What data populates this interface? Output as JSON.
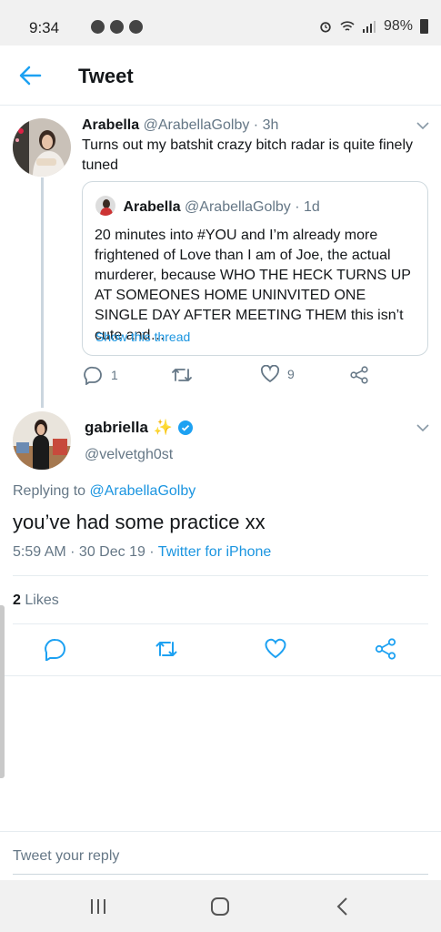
{
  "status_bar": {
    "time": "9:34",
    "battery": "98%"
  },
  "app_bar": {
    "title": "Tweet"
  },
  "parent_tweet": {
    "name": "Arabella",
    "handle": "@ArabellaGolby",
    "time": "· 3h",
    "text": "Turns out my batshit crazy bitch radar is quite finely tuned",
    "quoted": {
      "name": "Arabella",
      "handle": "@ArabellaGolby",
      "time": "· 1d",
      "text": "20 minutes into #YOU and I’m already more frightened of Love than I am of Joe, the actual murderer, because WHO THE HECK TURNS UP AT SOMEONES HOME UNINVITED ONE SINGLE DAY AFTER MEETING THEM this isn’t cute and…",
      "show_thread": "Show this thread"
    },
    "actions": {
      "reply_count": "1",
      "like_count": "9"
    }
  },
  "reply_tweet": {
    "name": "gabriella",
    "emoji": "✨",
    "handle": "@velvetgh0st",
    "replying_prefix": "Replying to",
    "replying_to": "@ArabellaGolby",
    "text": "you’ve had some practice xx",
    "timestamp": "5:59 AM · 30 Dec 19 ·",
    "source": "Twitter for iPhone",
    "likes_count": "2",
    "likes_label": "Likes"
  },
  "reply_composer": {
    "placeholder": "Tweet your reply"
  },
  "colors": {
    "accent": "#1b95e0",
    "secondary_text": "#657786",
    "verified": "#1da1f2"
  }
}
